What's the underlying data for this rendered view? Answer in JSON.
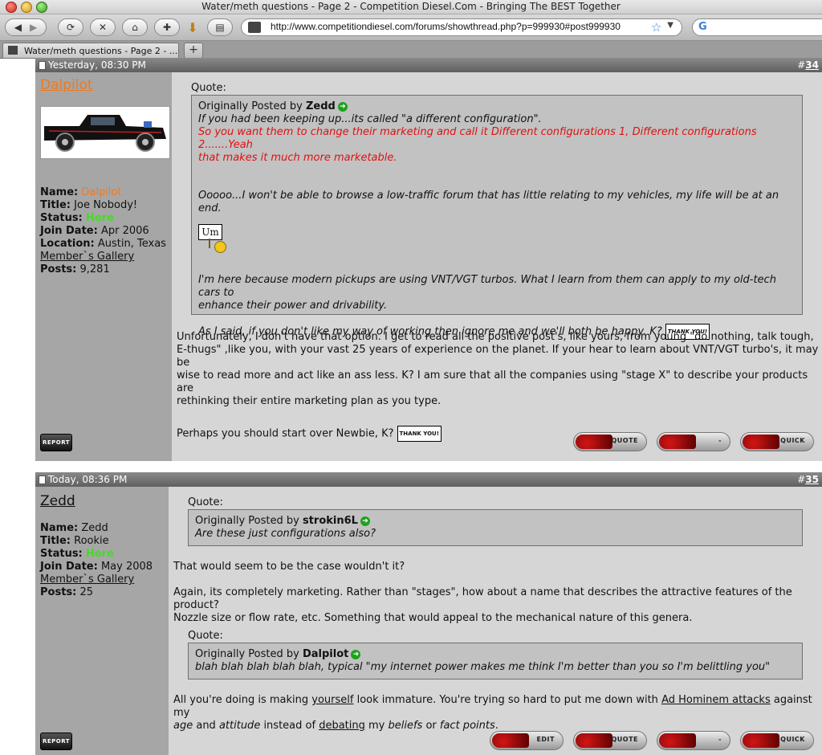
{
  "window": {
    "title": "Water/meth questions - Page 2 - Competition Diesel.Com - Bringing The BEST Together"
  },
  "toolbar": {
    "url": "http://www.competitiondiesel.com/forums/showthread.php?p=999930#post999930",
    "back_icon": "back-arrow-icon",
    "forward_icon": "forward-arrow-icon",
    "reload_icon": "reload-icon",
    "stop_icon": "stop-icon",
    "home_icon": "home-icon",
    "search_engine": "G"
  },
  "tabs": [
    {
      "label": "Water/meth questions - Page 2 - ..."
    }
  ],
  "posts": [
    {
      "date": "Yesterday, 08:30 PM",
      "number_prefix": "#",
      "number": "34",
      "username": "Dalpilot",
      "username_color": "#f07a1f",
      "info": {
        "name_label": "Name:",
        "name": "Dalpilot",
        "title_label": "Title:",
        "title": "Joe Nobody!",
        "status_label": "Status:",
        "status": "Here",
        "join_label": "Join Date:",
        "join": "Apr 2006",
        "location_label": "Location:",
        "location": "Austin, Texas",
        "gallery": "Member`s Gallery",
        "posts_label": "Posts:",
        "posts": "9,281"
      },
      "quote_label": "Quote:",
      "quote": {
        "posted_by_prefix": "Originally Posted by",
        "author": "Zedd",
        "line1": "If you had been keeping up...its called \"a different configuration\".",
        "red_line1": "So you want them to change their marketing and call it Different configurations 1, Different configurations 2.......Yeah",
        "red_line2": "that makes it much more marketable.",
        "para2": "Ooooo...I won't be able to browse a low-traffic forum that has little relating to my vehicles, my life will be at an end.",
        "sign_um": "Um",
        "para3a": "I'm here because modern pickups are using VNT/VGT turbos. What I learn from them can apply to my old-tech cars to",
        "para3b": "enhance their power and drivability.",
        "para4": "As I said, if you don't like my way of working then ignore me and we'll both be happy. K?",
        "sign_thanks": "THANK YOU!"
      },
      "body_p1a": "Unfortunately, I don't have that option. I get to read all the positive post's, like yours, from young \"do nothing, talk tough,",
      "body_p1b": "E-thugs\" ,like you, with your vast 25 years of experience on the planet. If your hear to learn about VNT/VGT turbo's, it may be",
      "body_p1c": "wise to read more and act like an ass less. K? I am sure that all the companies using \"stage X\" to describe your products are",
      "body_p1d": "rethinking their entire marketing plan as you type.",
      "body_p2": "Perhaps you should start over Newbie, K?",
      "sign_thanks2": "THANK YOU!",
      "report": "REPORT",
      "buttons": [
        "QUOTE",
        "-",
        "QUICK"
      ]
    },
    {
      "date": "Today, 08:36 PM",
      "number_prefix": "#",
      "number": "35",
      "username": "Zedd",
      "username_color": "#111111",
      "info": {
        "name_label": "Name:",
        "name": "Zedd",
        "title_label": "Title:",
        "title": "Rookie",
        "status_label": "Status:",
        "status": "Here",
        "join_label": "Join Date:",
        "join": "May 2008",
        "gallery": "Member`s Gallery",
        "posts_label": "Posts:",
        "posts": "25"
      },
      "quote1_label": "Quote:",
      "quote1": {
        "posted_by_prefix": "Originally Posted by",
        "author": "strokin6L",
        "text": "Are these just configurations also?"
      },
      "body_p1": "That would seem to be the case wouldn't it?",
      "body_p2a": "Again, its completely marketing. Rather than \"stages\", how about a name that describes the attractive features of the product?",
      "body_p2b": "Nozzle size or flow rate, etc. Something that would appeal to the mechanical nature of this genera.",
      "quote2_label": "Quote:",
      "quote2": {
        "posted_by_prefix": "Originally Posted by",
        "author": "Dalpilot",
        "text": "blah blah blah blah blah, typical \"my internet power makes me think I'm better than you so I'm belittling you\""
      },
      "body_p3": {
        "t1": "All you're doing is making ",
        "l1": "yourself",
        "t2": " look immature. You're trying so hard to put me down with ",
        "l2": "Ad Hominem attacks",
        "t3": " against my",
        "i1": "age",
        "t4": " and ",
        "i2": "attitude",
        "t5": " instead of ",
        "l3": "debating",
        "t6": " my ",
        "i3": "beliefs",
        "t7": " or ",
        "i4": "fact points",
        "t8": "."
      },
      "report": "REPORT",
      "buttons": [
        "EDIT",
        "QUOTE",
        "-",
        "QUICK"
      ]
    }
  ],
  "colors": {
    "status_here": "#44dd22",
    "quote_red": "#e01010",
    "header_bar": "#6b6b6b"
  }
}
